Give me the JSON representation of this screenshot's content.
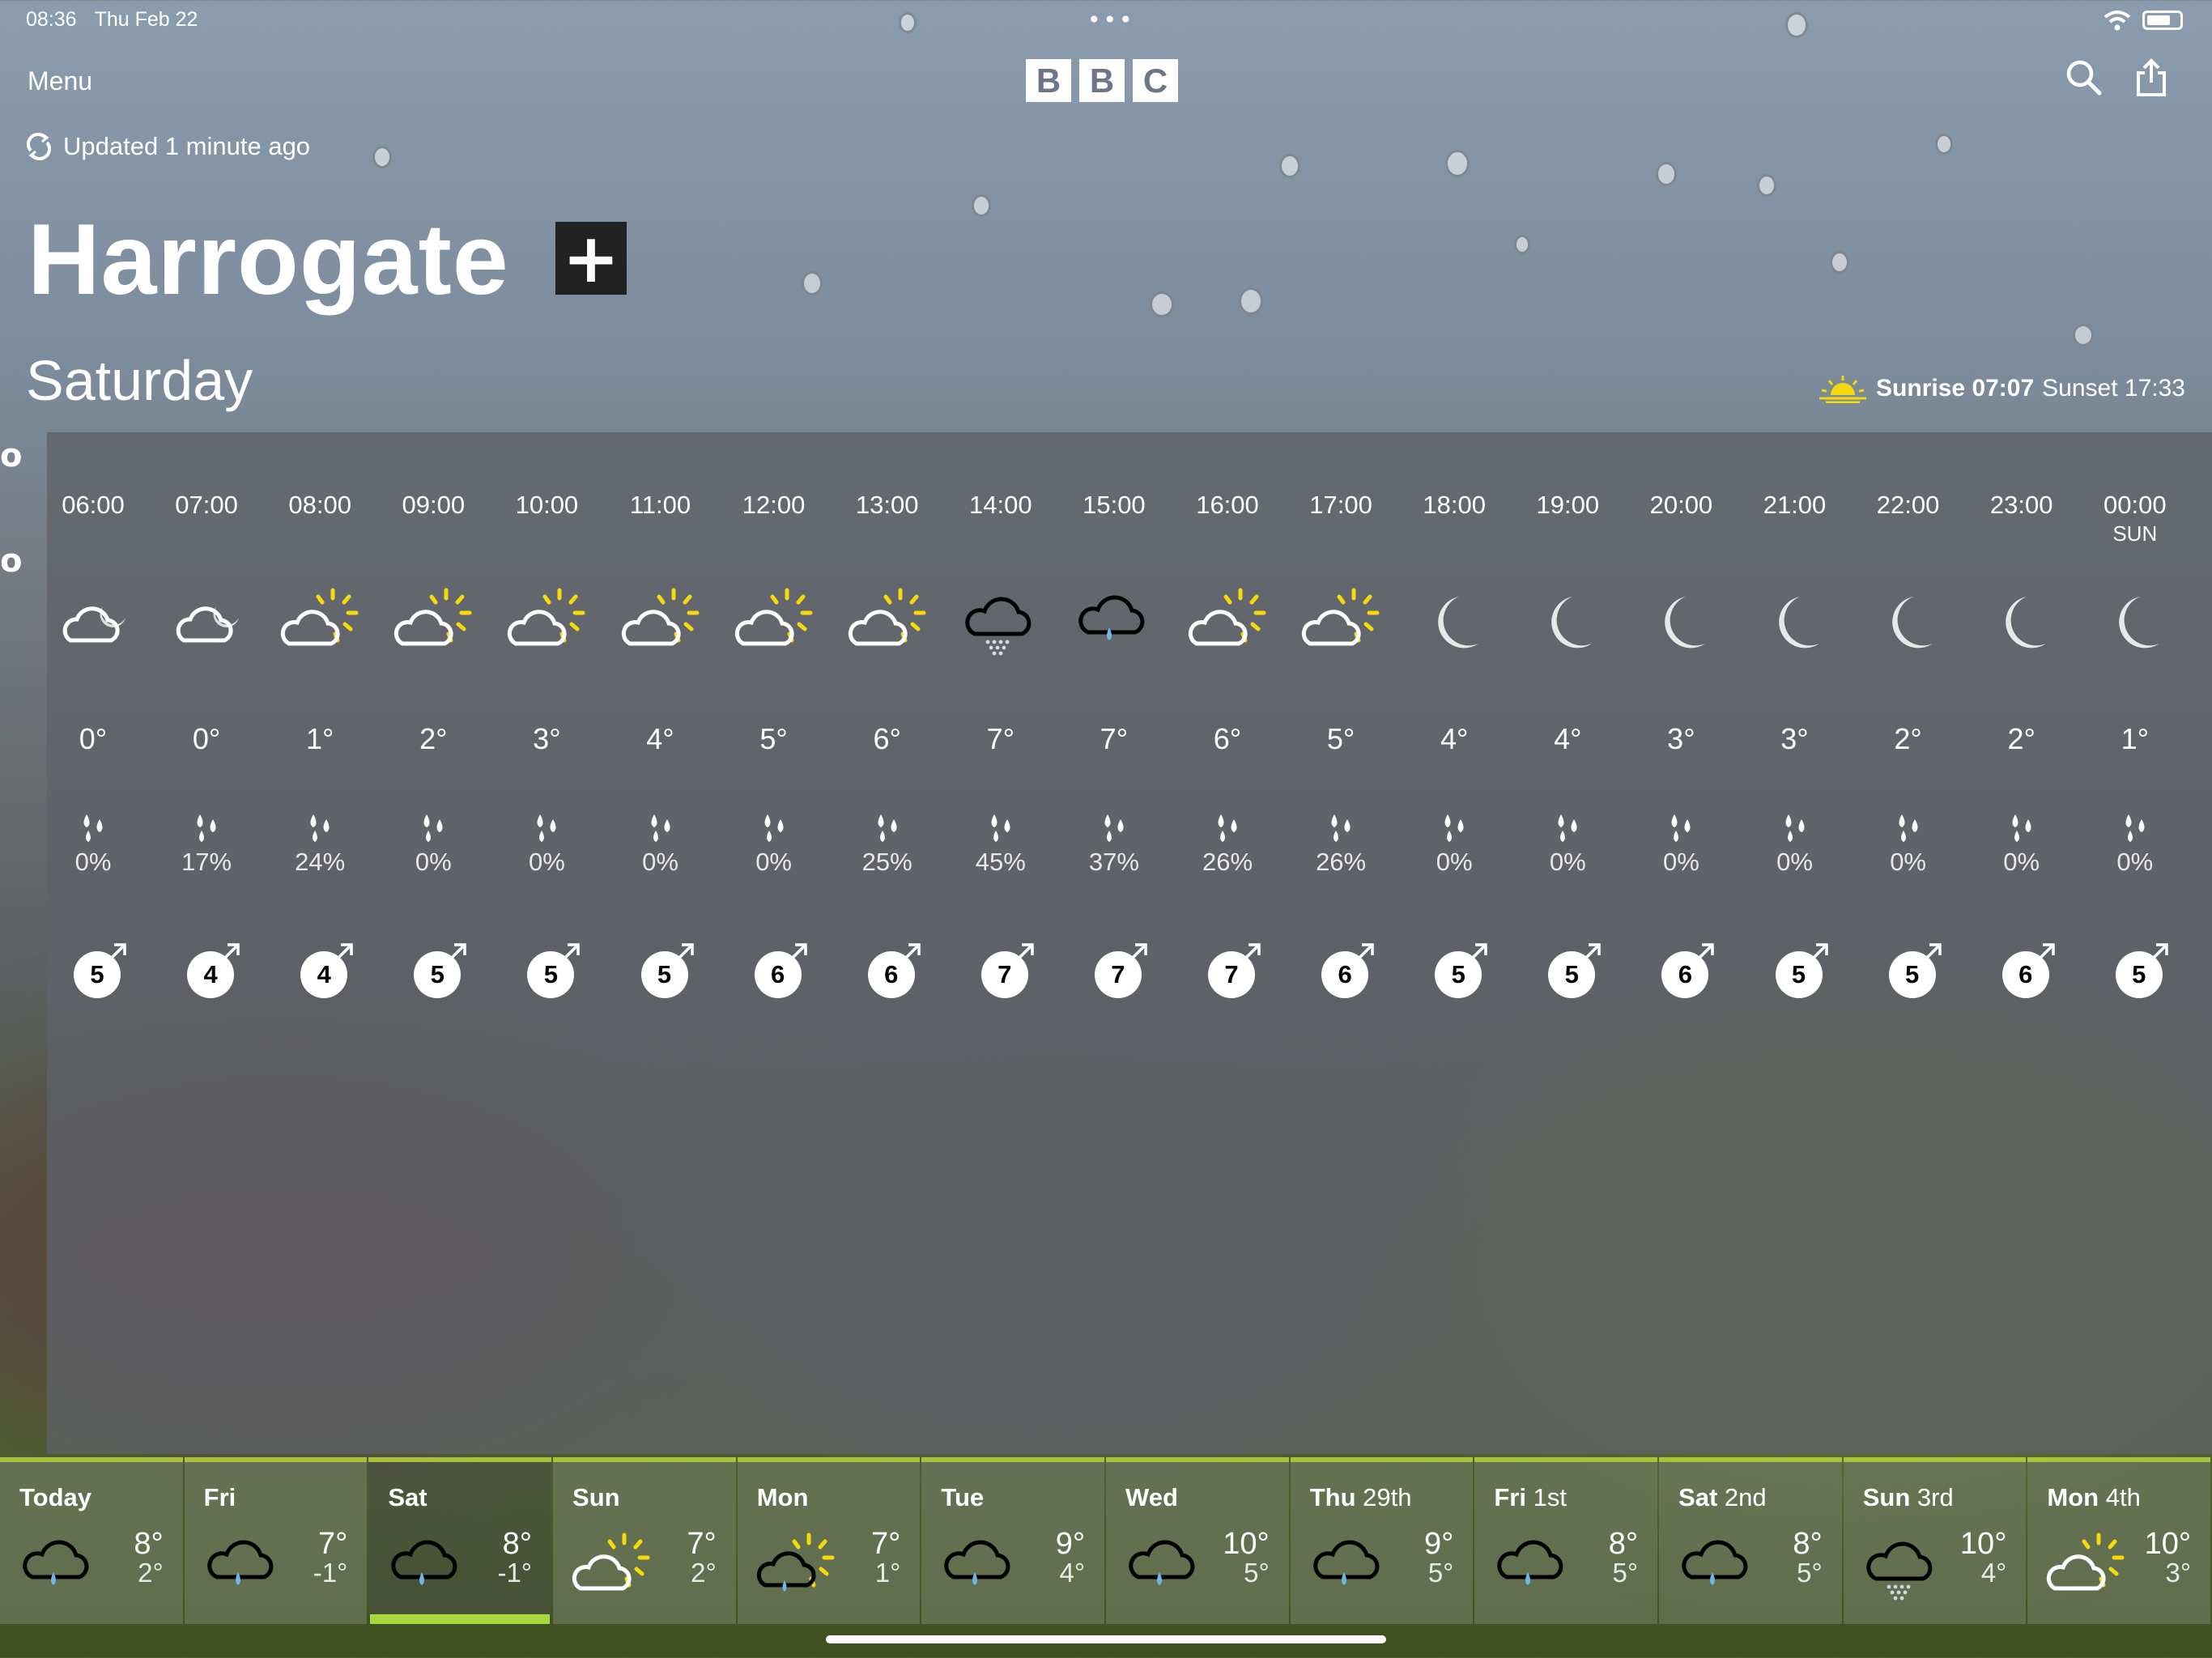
{
  "status_bar": {
    "time": "08:36",
    "date": "Thu Feb 22"
  },
  "header": {
    "menu_label": "Menu",
    "logo_letters": [
      "B",
      "B",
      "C"
    ]
  },
  "updated_text": "Updated 1 minute ago",
  "location": {
    "name": "Harrogate",
    "add_symbol": "+"
  },
  "selected_day": "Saturday",
  "sun_times": {
    "sunrise_label": "Sunrise",
    "sunrise": "07:07",
    "sunset_label": "Sunset",
    "sunset": "17:33"
  },
  "colors": {
    "sun": "#f5d90a",
    "accent_green": "#a8c23e",
    "selected_bar": "#a8d83a"
  },
  "hourly": [
    {
      "time": "06:00",
      "sub": "",
      "icon": "cloud-moon-icon",
      "temp": "0°",
      "rain": "0%",
      "wind": "5"
    },
    {
      "time": "07:00",
      "sub": "",
      "icon": "cloud-moon-icon",
      "temp": "0°",
      "rain": "17%",
      "wind": "4"
    },
    {
      "time": "08:00",
      "sub": "",
      "icon": "sun-cloud-icon",
      "temp": "1°",
      "rain": "24%",
      "wind": "4"
    },
    {
      "time": "09:00",
      "sub": "",
      "icon": "sun-cloud-icon",
      "temp": "2°",
      "rain": "0%",
      "wind": "5"
    },
    {
      "time": "10:00",
      "sub": "",
      "icon": "sun-cloud-icon",
      "temp": "3°",
      "rain": "0%",
      "wind": "5"
    },
    {
      "time": "11:00",
      "sub": "",
      "icon": "sun-cloud-icon",
      "temp": "4°",
      "rain": "0%",
      "wind": "5"
    },
    {
      "time": "12:00",
      "sub": "",
      "icon": "sun-cloud-icon",
      "temp": "5°",
      "rain": "0%",
      "wind": "6"
    },
    {
      "time": "13:00",
      "sub": "",
      "icon": "sun-cloud-icon",
      "temp": "6°",
      "rain": "25%",
      "wind": "6"
    },
    {
      "time": "14:00",
      "sub": "",
      "icon": "drizzle-icon",
      "temp": "7°",
      "rain": "45%",
      "wind": "7"
    },
    {
      "time": "15:00",
      "sub": "",
      "icon": "light-rain-icon",
      "temp": "7°",
      "rain": "37%",
      "wind": "7"
    },
    {
      "time": "16:00",
      "sub": "",
      "icon": "sun-cloud-icon",
      "temp": "6°",
      "rain": "26%",
      "wind": "7"
    },
    {
      "time": "17:00",
      "sub": "",
      "icon": "sun-cloud-icon",
      "temp": "5°",
      "rain": "26%",
      "wind": "6"
    },
    {
      "time": "18:00",
      "sub": "",
      "icon": "moon-icon",
      "temp": "4°",
      "rain": "0%",
      "wind": "5"
    },
    {
      "time": "19:00",
      "sub": "",
      "icon": "moon-icon",
      "temp": "4°",
      "rain": "0%",
      "wind": "5"
    },
    {
      "time": "20:00",
      "sub": "",
      "icon": "moon-icon",
      "temp": "3°",
      "rain": "0%",
      "wind": "6"
    },
    {
      "time": "21:00",
      "sub": "",
      "icon": "moon-icon",
      "temp": "3°",
      "rain": "0%",
      "wind": "5"
    },
    {
      "time": "22:00",
      "sub": "",
      "icon": "moon-icon",
      "temp": "2°",
      "rain": "0%",
      "wind": "5"
    },
    {
      "time": "23:00",
      "sub": "",
      "icon": "moon-icon",
      "temp": "2°",
      "rain": "0%",
      "wind": "6"
    },
    {
      "time": "00:00",
      "sub": "SUN",
      "icon": "moon-icon",
      "temp": "1°",
      "rain": "0%",
      "wind": "5"
    }
  ],
  "daily": [
    {
      "day": "Today",
      "suffix": "",
      "icon": "light-rain-icon",
      "high": "8°",
      "low": "2°"
    },
    {
      "day": "Fri",
      "suffix": "",
      "icon": "light-rain-icon",
      "high": "7°",
      "low": "-1°"
    },
    {
      "day": "Sat",
      "suffix": "",
      "icon": "light-rain-icon",
      "high": "8°",
      "low": "-1°",
      "selected": true
    },
    {
      "day": "Sun",
      "suffix": "",
      "icon": "sun-cloud-icon",
      "high": "7°",
      "low": "2°"
    },
    {
      "day": "Mon",
      "suffix": "",
      "icon": "sun-rain-icon",
      "high": "7°",
      "low": "1°"
    },
    {
      "day": "Tue",
      "suffix": "",
      "icon": "light-rain-icon",
      "high": "9°",
      "low": "4°"
    },
    {
      "day": "Wed",
      "suffix": "",
      "icon": "light-rain-icon",
      "high": "10°",
      "low": "5°"
    },
    {
      "day": "Thu",
      "suffix": "29th",
      "icon": "light-rain-icon",
      "high": "9°",
      "low": "5°"
    },
    {
      "day": "Fri",
      "suffix": "1st",
      "icon": "light-rain-icon",
      "high": "8°",
      "low": "5°"
    },
    {
      "day": "Sat",
      "suffix": "2nd",
      "icon": "light-rain-icon",
      "high": "8°",
      "low": "5°"
    },
    {
      "day": "Sun",
      "suffix": "3rd",
      "icon": "drizzle-icon",
      "high": "10°",
      "low": "4°"
    },
    {
      "day": "Mon",
      "suffix": "4th",
      "icon": "sun-cloud-icon",
      "high": "10°",
      "low": "3°"
    }
  ]
}
